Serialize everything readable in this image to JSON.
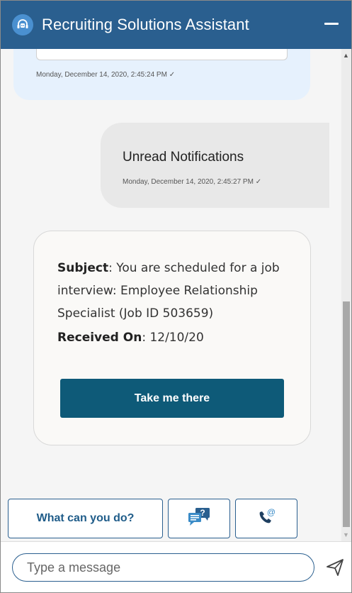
{
  "header": {
    "title": "Recruiting Solutions Assistant",
    "bot_icon": "headset-bot-icon",
    "minimize_icon": "minimize-icon"
  },
  "messages": {
    "previous_bot": {
      "timestamp": "Monday, December 14, 2020, 2:45:24 PM ✓"
    },
    "user": {
      "text": "Unread Notifications",
      "timestamp": "Monday, December 14, 2020, 2:45:27 PM ✓"
    },
    "notification_card": {
      "subject_label": "Subject",
      "subject_text": ": You are scheduled for a job interview: Employee Relationship Specialist (Job ID 503659)",
      "received_label": "Received On",
      "received_text": ": 12/10/20",
      "cta_label": "Take me there"
    }
  },
  "quick_actions": {
    "what_can_you_do": "What can you do?",
    "faq_icon": "chat-question-icon",
    "contact_icon": "phone-at-icon"
  },
  "input": {
    "placeholder": "Type a message",
    "send_icon": "send-icon"
  },
  "colors": {
    "header_bg": "#2a5f8f",
    "cta_bg": "#0e5a78",
    "bot_bubble_bg": "#e6f1fd",
    "user_bubble_bg": "#e8e8e8",
    "accent_text": "#1f5c89"
  }
}
